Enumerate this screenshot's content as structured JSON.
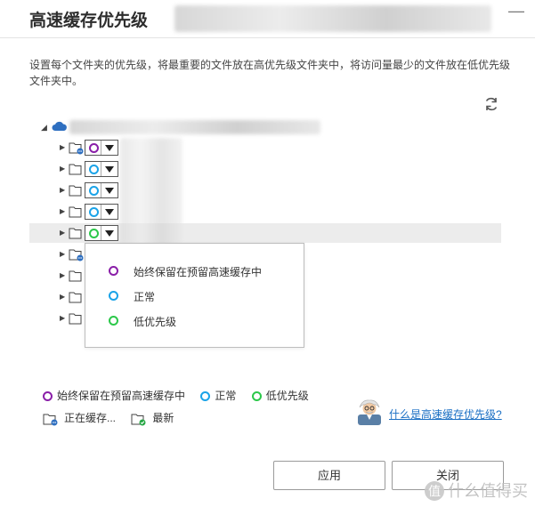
{
  "window": {
    "title": "高速缓存优先级",
    "close_label": "—"
  },
  "description": "设置每个文件夹的优先级，将最重要的文件放在高优先级文件夹中，将访问量最少的文件放在低优先级文件夹中。",
  "colors": {
    "purple": "#8a1fa8",
    "blue": "#1aa3e8",
    "green": "#2cc84a",
    "link": "#1a6fc4"
  },
  "tree": {
    "rows": [
      {
        "folder_state": "caching",
        "priority": "purple"
      },
      {
        "folder_state": "normal",
        "priority": "blue"
      },
      {
        "folder_state": "normal",
        "priority": "blue"
      },
      {
        "folder_state": "normal",
        "priority": "blue"
      },
      {
        "folder_state": "normal",
        "priority": "green",
        "highlighted": true
      },
      {
        "folder_state": "caching"
      },
      {
        "folder_state": "normal"
      },
      {
        "folder_state": "normal"
      },
      {
        "folder_state": "normal"
      }
    ]
  },
  "dropdown_menu": {
    "items": [
      {
        "label": "始终保留在预留高速缓存中",
        "color": "purple"
      },
      {
        "label": "正常",
        "color": "blue"
      },
      {
        "label": "低优先级",
        "color": "green"
      }
    ]
  },
  "legend": {
    "always_keep": "始终保留在预留高速缓存中",
    "normal": "正常",
    "low": "低优先级",
    "caching": "正在缓存...",
    "latest": "最新"
  },
  "help_link": "什么是高速缓存优先级?",
  "buttons": {
    "apply": "应用",
    "close": "关闭"
  },
  "watermark": {
    "badge": "值",
    "text": "什么值得买"
  }
}
